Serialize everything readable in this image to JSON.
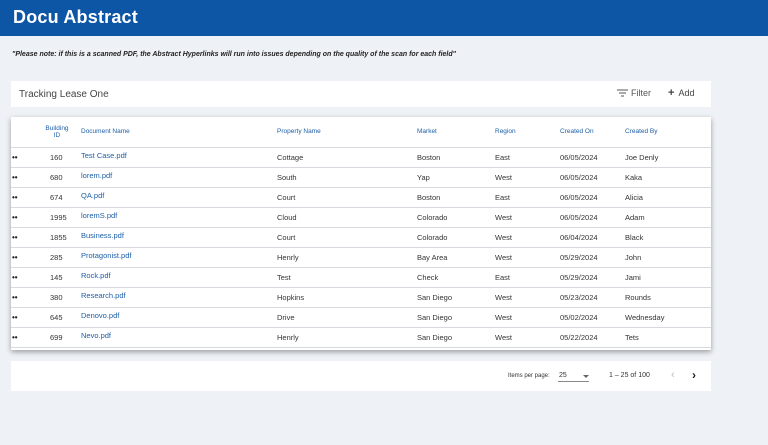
{
  "app": {
    "title": "Docu Abstract"
  },
  "note": "\"Please note: if this is a scanned PDF, the Abstract Hyperlinks will run into issues depending on the quality of the scan for each field\"",
  "card": {
    "title": "Tracking Lease One",
    "filter_label": "Filter",
    "add_label": "Add",
    "filter_icon": "filter-lines-icon",
    "add_icon": "plus-icon"
  },
  "table": {
    "columns": {
      "building_id_line1": "Building",
      "building_id_line2": "ID",
      "document_name": "Document Name",
      "property_name": "Property Name",
      "market": "Market",
      "region": "Region",
      "created_on": "Created On",
      "created_by": "Created By"
    },
    "row_menu_glyph": "••",
    "rows": [
      {
        "id": "160",
        "doc": "Test Case.pdf",
        "property": "Cottage",
        "market": "Boston",
        "region": "East",
        "created_on": "06/05/2024",
        "created_by": "Joe Denly"
      },
      {
        "id": "680",
        "doc": "lorem.pdf",
        "property": "South",
        "market": "Yap",
        "region": "West",
        "created_on": "06/05/2024",
        "created_by": "Kaka"
      },
      {
        "id": "674",
        "doc": "QA.pdf",
        "property": "Court",
        "market": "Boston",
        "region": "East",
        "created_on": "06/05/2024",
        "created_by": "Alicia"
      },
      {
        "id": "1995",
        "doc": "loremS.pdf",
        "property": "Cloud",
        "market": "Colorado",
        "region": "West",
        "created_on": "06/05/2024",
        "created_by": "Adam"
      },
      {
        "id": "1855",
        "doc": "Business.pdf",
        "property": "Court",
        "market": "Colorado",
        "region": "West",
        "created_on": "06/04/2024",
        "created_by": "Black"
      },
      {
        "id": "285",
        "doc": "Protagonist.pdf",
        "property": "Henrly",
        "market": "Bay Area",
        "region": "West",
        "created_on": "05/29/2024",
        "created_by": "John"
      },
      {
        "id": "145",
        "doc": "Rock.pdf",
        "property": "Test",
        "market": "Check",
        "region": "East",
        "created_on": "05/29/2024",
        "created_by": "Jami"
      },
      {
        "id": "380",
        "doc": "Research.pdf",
        "property": "Hopkins",
        "market": "San Diego",
        "region": "West",
        "created_on": "05/23/2024",
        "created_by": "Rounds"
      },
      {
        "id": "645",
        "doc": "Denovo.pdf",
        "property": "Drive",
        "market": "San Diego",
        "region": "West",
        "created_on": "05/02/2024",
        "created_by": "Wednesday"
      },
      {
        "id": "699",
        "doc": "Nevo.pdf",
        "property": "Henrly",
        "market": "San Diego",
        "region": "West",
        "created_on": "05/22/2024",
        "created_by": "Tets"
      }
    ]
  },
  "pagination": {
    "items_per_page_label": "Items per page:",
    "items_per_page_value": "25",
    "range_label": "1 – 25 of 100",
    "prev_icon": "chevron-left-icon",
    "next_icon": "chevron-right-icon",
    "prev_glyph": "‹",
    "next_glyph": "›"
  },
  "colors": {
    "brand": "#0d56a6",
    "link": "#1d5fa8",
    "background": "#eef1f5"
  }
}
